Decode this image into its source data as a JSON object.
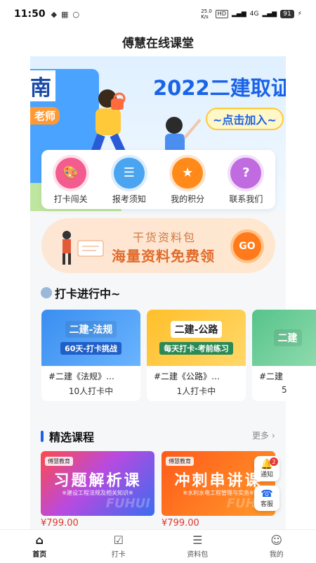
{
  "status_bar": {
    "time": "11:50",
    "battery": "91",
    "network": "4G",
    "hd": "HD",
    "speed": "25.0\nK/s"
  },
  "header": {
    "title": "傅慧在线课堂"
  },
  "banner": {
    "left_text": "南",
    "teacher_text": "老师",
    "headline": "2022二建取证",
    "cta": "~点击加入~"
  },
  "nav": {
    "items": [
      {
        "label": "打卡闯关",
        "icon": "palette-icon",
        "color": "#f25c8f"
      },
      {
        "label": "报考须知",
        "icon": "document-icon",
        "color": "#4aa4f0"
      },
      {
        "label": "我的积分",
        "icon": "badge-icon",
        "color": "#ff8a1a"
      },
      {
        "label": "联系我们",
        "icon": "question-icon",
        "color": "#c06be0"
      }
    ]
  },
  "promo": {
    "line1": "干货资料包",
    "line2": "海量资料免费领",
    "go": "GO"
  },
  "checkin": {
    "title": "打卡进行中~",
    "cards": [
      {
        "img_big": "二建-法规",
        "img_small": "60天-打卡挑战",
        "title": "#二建《法规》…",
        "count": "10人打卡中",
        "bg": "#3a8ef0"
      },
      {
        "img_big": "二建-公路",
        "img_small": "每天打卡-考前练习",
        "title": "#二建《公路》…",
        "count": "1人打卡中",
        "bg": "#ffbf2a"
      },
      {
        "img_big": "二建",
        "img_small": "",
        "title": "#二建",
        "count": "5",
        "bg": "#56c38a"
      }
    ]
  },
  "courses": {
    "title": "精选课程",
    "more": "更多",
    "items": [
      {
        "badge": "傅慧教育",
        "name": "习题解析课",
        "sub": "※建设工程法规及相关知识※",
        "watermark": "FUHUI",
        "price": "¥799.00"
      },
      {
        "badge": "傅慧教育",
        "name": "冲刺串讲课",
        "sub": "※水利水电工程管理与实务※",
        "watermark": "FUHUI",
        "price": "¥799.00"
      }
    ]
  },
  "float": {
    "notice_label": "通知",
    "notice_badge": "2",
    "service_label": "客服"
  },
  "tabbar": {
    "items": [
      {
        "label": "首页",
        "icon": "home-icon"
      },
      {
        "label": "打卡",
        "icon": "checkin-icon"
      },
      {
        "label": "资料包",
        "icon": "list-icon"
      },
      {
        "label": "我的",
        "icon": "user-icon"
      }
    ]
  }
}
